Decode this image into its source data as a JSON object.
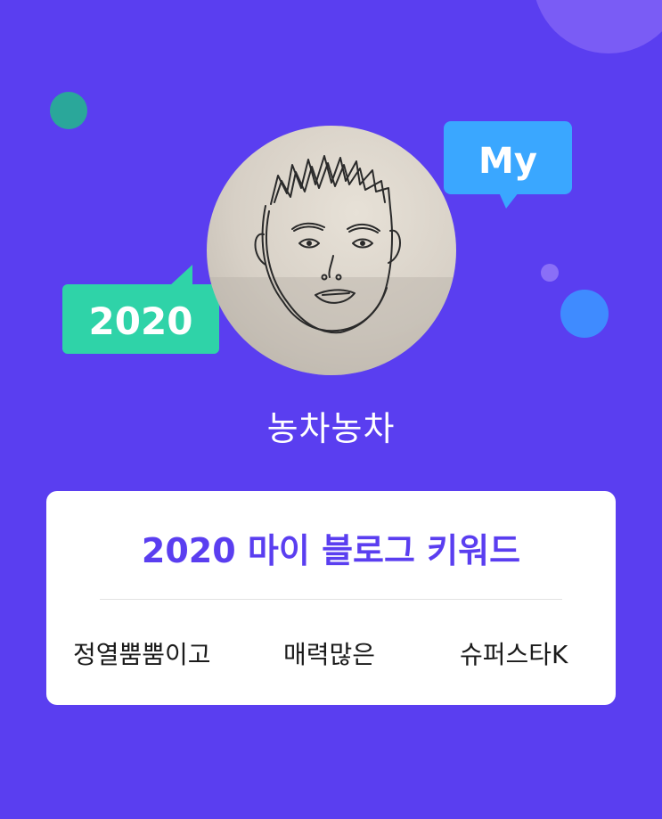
{
  "colors": {
    "background": "#5a3ef0",
    "accent_purple": "#5a3ef0",
    "teal_bubble": "#2fd3a8",
    "blue_bubble": "#3aa7ff",
    "card": "#ffffff"
  },
  "badges": {
    "year_bubble": "2020",
    "my_bubble": "My"
  },
  "profile": {
    "avatar_icon": "hand-drawn-face-avatar",
    "nickname": "농차농차"
  },
  "keywords_card": {
    "title": "2020 마이 블로그 키워드",
    "keywords": [
      "정열뿜뿜이고",
      "매력많은",
      "슈퍼스타K"
    ]
  }
}
